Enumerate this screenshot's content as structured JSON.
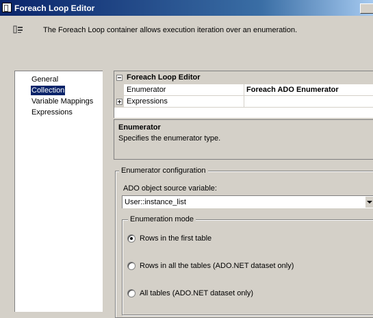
{
  "window": {
    "title": "Foreach Loop Editor"
  },
  "description": "The Foreach Loop container allows execution iteration over an enumeration.",
  "nav": {
    "items": [
      {
        "label": "General"
      },
      {
        "label": "Collection"
      },
      {
        "label": "Variable Mappings"
      },
      {
        "label": "Expressions"
      }
    ],
    "selected": "Collection"
  },
  "property_grid": {
    "category": "Foreach Loop Editor",
    "rows": [
      {
        "name": "Enumerator",
        "value": "Foreach ADO Enumerator"
      },
      {
        "name": "Expressions",
        "value": ""
      }
    ]
  },
  "help": {
    "title": "Enumerator",
    "description": "Specifies the enumerator type."
  },
  "config": {
    "group_label": "Enumerator configuration",
    "ado_label": "ADO object source variable:",
    "ado_value": "User::instance_list",
    "mode_label": "Enumeration mode",
    "modes": [
      {
        "label": "Rows in the first table",
        "checked": true
      },
      {
        "label": "Rows in all the tables (ADO.NET dataset only)",
        "checked": false
      },
      {
        "label": "All tables (ADO.NET dataset only)",
        "checked": false
      }
    ]
  },
  "colors": {
    "selection": "#0a246a",
    "face": "#d4d0c8"
  }
}
